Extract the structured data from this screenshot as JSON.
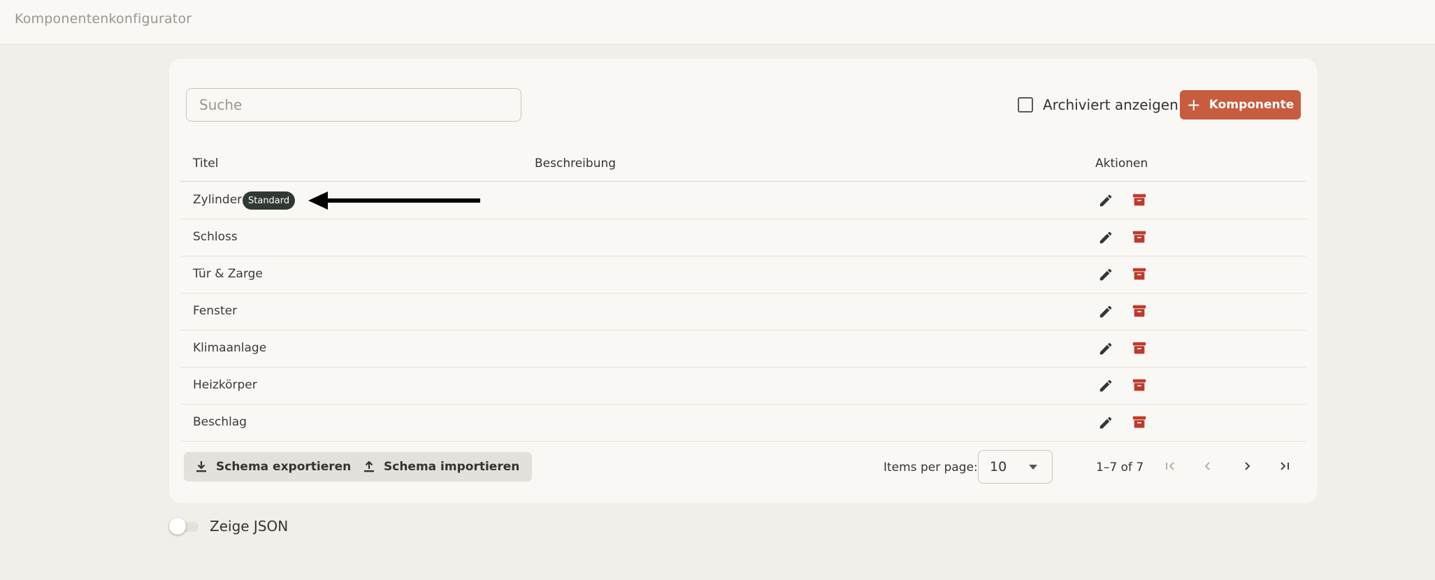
{
  "app": {
    "title": "Komponentenkonfigurator"
  },
  "toolbar": {
    "search_placeholder": "Suche",
    "search_value": "",
    "archived_label": "Archiviert anzeigen",
    "archived_checked": false,
    "add_label": "Komponente",
    "add_color": "#c85c3f"
  },
  "table": {
    "headers": [
      "Titel",
      "Beschreibung",
      "Aktionen"
    ],
    "rows": [
      {
        "title": "Zylinder",
        "badge": "Standard",
        "description": ""
      },
      {
        "title": "Schloss",
        "description": ""
      },
      {
        "title": "Tür & Zarge",
        "description": ""
      },
      {
        "title": "Fenster",
        "description": ""
      },
      {
        "title": "Klimaanlage",
        "description": ""
      },
      {
        "title": "Heizkörper",
        "description": ""
      },
      {
        "title": "Beschlag",
        "description": ""
      }
    ],
    "action_icons": [
      "pencil-icon",
      "archive-icon"
    ],
    "edit_color": "#2f3a33",
    "archive_color": "#c0392b"
  },
  "footer": {
    "export_label": "Schema exportieren",
    "import_label": "Schema importieren",
    "items_per_page_label": "Items per page:",
    "items_per_page_value": "10",
    "range_label": "1–7 of 7"
  },
  "json_toggle": {
    "label": "Zeige JSON",
    "on": false
  }
}
